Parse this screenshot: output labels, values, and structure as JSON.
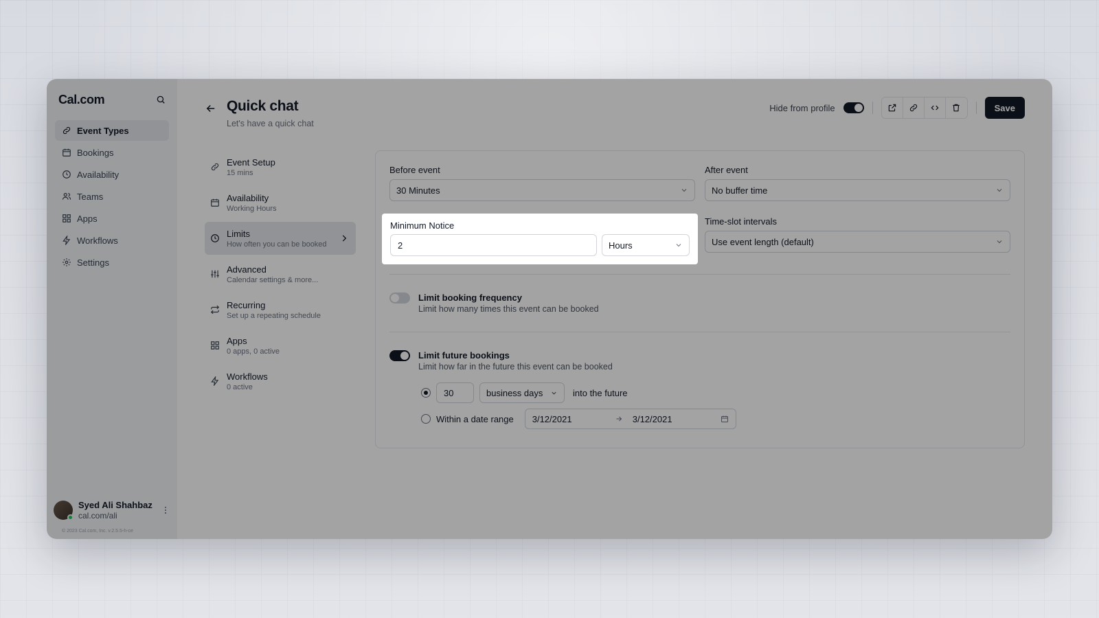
{
  "sidebar": {
    "brand": "Cal.com",
    "items": [
      {
        "label": "Event Types",
        "icon": "link-icon",
        "active": true
      },
      {
        "label": "Bookings",
        "icon": "calendar-icon"
      },
      {
        "label": "Availability",
        "icon": "clock-icon"
      },
      {
        "label": "Teams",
        "icon": "users-icon"
      },
      {
        "label": "Apps",
        "icon": "grid-icon"
      },
      {
        "label": "Workflows",
        "icon": "zap-icon"
      },
      {
        "label": "Settings",
        "icon": "gear-icon"
      }
    ],
    "user": {
      "name": "Syed Ali Shahbaz",
      "link": "cal.com/ali"
    },
    "copyright": "© 2023 Cal.com, Inc. v.2.5.5-h-ce"
  },
  "header": {
    "title": "Quick chat",
    "subtitle": "Let's have a quick chat",
    "hide_from_profile_label": "Hide from profile",
    "hide_from_profile_on": true,
    "save_label": "Save"
  },
  "tabs": [
    {
      "title": "Event Setup",
      "sub": "15 mins",
      "icon": "link-icon"
    },
    {
      "title": "Availability",
      "sub": "Working Hours",
      "icon": "calendar-icon"
    },
    {
      "title": "Limits",
      "sub": "How often you can be booked",
      "icon": "clock-icon",
      "active": true
    },
    {
      "title": "Advanced",
      "sub": "Calendar settings & more...",
      "icon": "sliders-icon"
    },
    {
      "title": "Recurring",
      "sub": "Set up a repeating schedule",
      "icon": "repeat-icon"
    },
    {
      "title": "Apps",
      "sub": "0 apps, 0 active",
      "icon": "grid-icon"
    },
    {
      "title": "Workflows",
      "sub": "0 active",
      "icon": "zap-icon"
    }
  ],
  "limits": {
    "before_event": {
      "label": "Before event",
      "value": "30 Minutes"
    },
    "after_event": {
      "label": "After event",
      "value": "No buffer time"
    },
    "minimum_notice": {
      "label": "Minimum Notice",
      "value": "2",
      "unit": "Hours"
    },
    "time_slot": {
      "label": "Time-slot intervals",
      "value": "Use event length (default)"
    },
    "booking_frequency": {
      "title": "Limit booking frequency",
      "sub": "Limit how many times this event can be booked",
      "on": false
    },
    "future_bookings": {
      "title": "Limit future bookings",
      "sub": "Limit how far in the future this event can be booked",
      "on": true,
      "days_value": "30",
      "days_unit": "business days",
      "into_future": "into the future",
      "range_label": "Within a date range",
      "range_start": "3/12/2021",
      "range_end": "3/12/2021"
    }
  },
  "colors": {
    "accent": "#111827",
    "status_online": "#22c55e"
  }
}
